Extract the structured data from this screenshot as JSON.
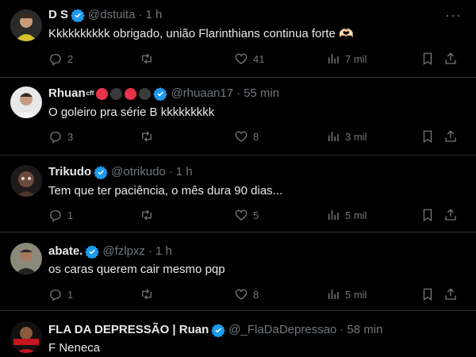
{
  "tweets": [
    {
      "name": "D S",
      "handle": "@dstuita",
      "time": "1 h",
      "text": "Kkkkkkkkkk obrigado, união Flarinthians continua forte 🫶🏻",
      "replies": "2",
      "retweets": "",
      "likes": "41",
      "views": "7 mil",
      "verified": true
    },
    {
      "name": "Rhuan",
      "name_suffix": "cff",
      "handle": "@rhuaan17",
      "time": "55 min",
      "text": "O goleiro pra série B kkkkkkkkk",
      "replies": "3",
      "retweets": "",
      "likes": "8",
      "views": "3 mil",
      "verified": true,
      "badge_colors": [
        "#e8334a",
        "#3a3a3a",
        "#e8334a",
        "#3a3a3a"
      ]
    },
    {
      "name": "Trikudo",
      "handle": "@otrikudo",
      "time": "1 h",
      "text": "Tem que ter paciência, o mês dura 90 dias...",
      "replies": "1",
      "retweets": "",
      "likes": "5",
      "views": "5 mil",
      "verified": true
    },
    {
      "name": "abate.",
      "handle": "@fzlpxz",
      "time": "1 h",
      "text": "os caras querem cair mesmo pqp",
      "replies": "1",
      "retweets": "",
      "likes": "8",
      "views": "5 mil",
      "verified": true
    },
    {
      "name": "FLA DA DEPRESSÃO | Ruan",
      "handle": "@_FlaDaDepressao",
      "time": "58 min",
      "text": "F Neneca",
      "verified": true
    }
  ],
  "colors": {
    "background": "#000000",
    "text": "#e7e9ea",
    "muted": "#71767b",
    "verified": "#1d9bf0",
    "divider": "#2f3336"
  },
  "icons": [
    "reply-icon",
    "retweet-icon",
    "like-icon",
    "views-icon",
    "bookmark-icon",
    "share-icon",
    "verified-badge-icon",
    "more-icon"
  ]
}
